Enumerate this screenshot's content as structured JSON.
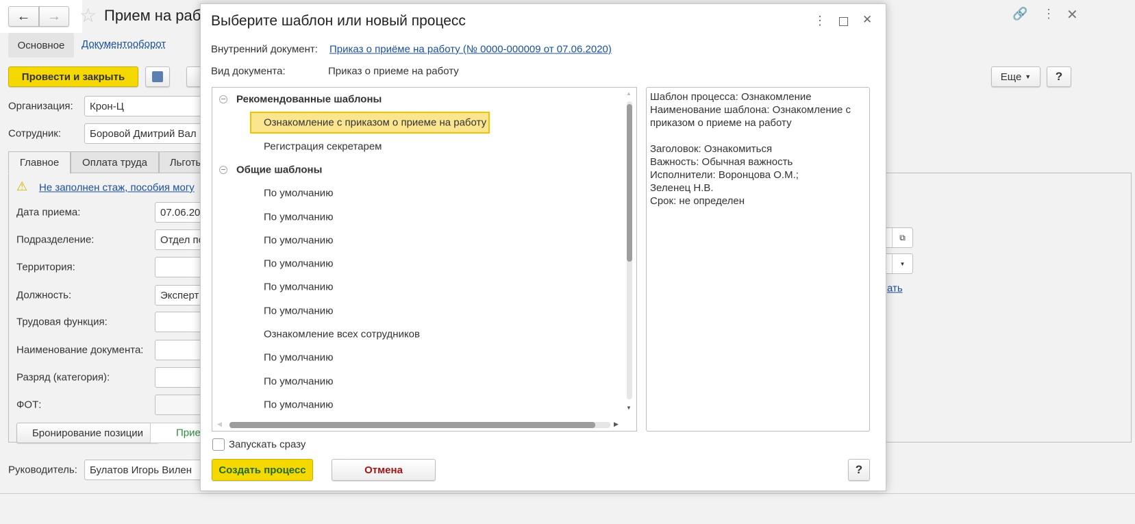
{
  "background": {
    "title": "Прием на раб",
    "tabs_top": [
      "Основное",
      "Документооборот"
    ],
    "post_close_label": "Провести и закрыть",
    "more_label": "Еще",
    "help_label": "?",
    "organization_label": "Организация:",
    "organization_value": "Крон-Ц",
    "employee_label": "Сотрудник:",
    "employee_value": "Боровой Дмитрий Вал",
    "tabs": [
      "Главное",
      "Оплата труда",
      "Льготы"
    ],
    "warning_text": "Не заполнен стаж, пособия могу",
    "fields": [
      {
        "label": "Дата приема:",
        "value": "07.06.20"
      },
      {
        "label": "Подразделение:",
        "value": "Отдел по"
      },
      {
        "label": "Территория:",
        "value": ""
      },
      {
        "label": "Должность:",
        "value": "Эксперт"
      },
      {
        "label": "Трудовая функция:",
        "value": ""
      },
      {
        "label": "Наименование документа:",
        "value": ""
      },
      {
        "label": "Разряд (категория):",
        "value": ""
      },
      {
        "label": "ФОТ:",
        "value": ""
      }
    ],
    "reserve_button": "Бронирование позиции",
    "reserve_status": "Прие",
    "manager_label": "Руководитель:",
    "manager_value": "Булатов Игорь Вилен",
    "right_link_fragment": "ать"
  },
  "dialog": {
    "title": "Выберите шаблон или новый процесс",
    "internal_doc_label": "Внутренний документ:",
    "internal_doc_link": "Приказ о приёме на работу (№ 0000-000009 от 07.06.2020)",
    "doc_type_label": "Вид документа:",
    "doc_type_value": "Приказ о приеме на работу",
    "groups": [
      {
        "name": "Рекомендованные шаблоны",
        "items": [
          "Ознакомление с приказом о приеме на работу",
          "Регистрация секретарем"
        ]
      },
      {
        "name": "Общие шаблоны",
        "items": [
          "По умолчанию",
          "По умолчанию",
          "По умолчанию",
          "По умолчанию",
          "По умолчанию",
          "По умолчанию",
          "Ознакомление всех сотрудников",
          "По умолчанию",
          "По умолчанию",
          "По умолчанию"
        ]
      }
    ],
    "selected_item": "Ознакомление с приказом о приеме на работу",
    "details": [
      "Шаблон процесса: Ознакомление",
      "Наименование шаблона: Ознакомление с",
      "приказом о приеме на работу",
      "",
      "Заголовок: Ознакомиться",
      "Важность: Обычная важность",
      "Исполнители: Воронцова О.М.;",
      "Зеленец Н.В.",
      "Срок: не определен"
    ],
    "start_now_label": "Запускать сразу",
    "start_now_checked": false,
    "create_label": "Создать процесс",
    "cancel_label": "Отмена",
    "help_label": "?"
  },
  "colors": {
    "accent_yellow": "#f5d800",
    "link": "#1a4f9c",
    "selection": "#fbe58f",
    "create_text": "#1e6b1e",
    "cancel_text": "#a31515"
  }
}
